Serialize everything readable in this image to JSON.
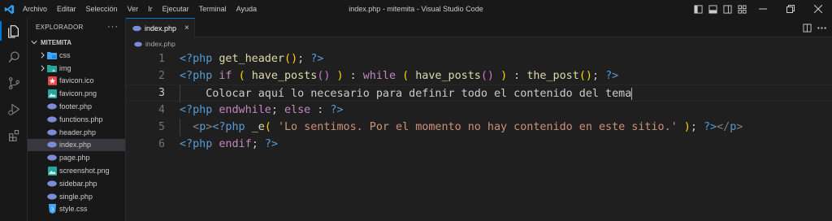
{
  "window": {
    "title": "index.php - mitemita - Visual Studio Code",
    "menu": [
      "Archivo",
      "Editar",
      "Selección",
      "Ver",
      "Ir",
      "Ejecutar",
      "Terminal",
      "Ayuda"
    ]
  },
  "sidebar": {
    "header": "EXPLORADOR",
    "more": "···",
    "folder": "MITEMITA",
    "items": [
      {
        "label": "css",
        "kind": "folder",
        "icon": "folder-css-icon"
      },
      {
        "label": "img",
        "kind": "folder",
        "icon": "folder-image-icon"
      },
      {
        "label": "favicon.ico",
        "kind": "file",
        "icon": "favicon-icon",
        "color": "#e8424b"
      },
      {
        "label": "favicon.png",
        "kind": "file",
        "icon": "image-file-icon",
        "color": "#26a69a"
      },
      {
        "label": "footer.php",
        "kind": "file",
        "icon": "php-icon",
        "color": "#7b8bd4"
      },
      {
        "label": "functions.php",
        "kind": "file",
        "icon": "php-icon",
        "color": "#7b8bd4"
      },
      {
        "label": "header.php",
        "kind": "file",
        "icon": "php-icon",
        "color": "#7b8bd4"
      },
      {
        "label": "index.php",
        "kind": "file",
        "icon": "php-icon",
        "color": "#7b8bd4",
        "selected": true
      },
      {
        "label": "page.php",
        "kind": "file",
        "icon": "php-icon",
        "color": "#7b8bd4"
      },
      {
        "label": "screenshot.png",
        "kind": "file",
        "icon": "image-file-icon",
        "color": "#26a69a"
      },
      {
        "label": "sidebar.php",
        "kind": "file",
        "icon": "php-icon",
        "color": "#7b8bd4"
      },
      {
        "label": "single.php",
        "kind": "file",
        "icon": "php-icon",
        "color": "#7b8bd4"
      },
      {
        "label": "style.css",
        "kind": "file",
        "icon": "css-file-icon",
        "color": "#42a5f5"
      }
    ]
  },
  "editor": {
    "tab_label": "index.php",
    "tab_close": "×",
    "breadcrumb": "index.php",
    "current_line": 3,
    "lines": [
      {
        "n": "1",
        "tokens": [
          [
            "<?php",
            "t-tag"
          ],
          [
            " ",
            "t-pu"
          ],
          [
            "get_header",
            "t-fn"
          ],
          [
            "(",
            "t-p1"
          ],
          [
            ")",
            "t-p1"
          ],
          [
            "; ",
            "t-pu"
          ],
          [
            "?>",
            "t-tag"
          ]
        ]
      },
      {
        "n": "2",
        "tokens": [
          [
            "<?php",
            "t-tag"
          ],
          [
            " ",
            "t-pu"
          ],
          [
            "if",
            "t-kw"
          ],
          [
            " ",
            "t-pu"
          ],
          [
            "(",
            "t-p1"
          ],
          [
            " ",
            "t-pu"
          ],
          [
            "have_posts",
            "t-fn"
          ],
          [
            "()",
            "t-p2"
          ],
          [
            " ",
            "t-pu"
          ],
          [
            ")",
            "t-p1"
          ],
          [
            " : ",
            "t-pu"
          ],
          [
            "while",
            "t-kw"
          ],
          [
            " ",
            "t-pu"
          ],
          [
            "(",
            "t-p1"
          ],
          [
            " ",
            "t-pu"
          ],
          [
            "have_posts",
            "t-fn"
          ],
          [
            "()",
            "t-p2"
          ],
          [
            " ",
            "t-pu"
          ],
          [
            ")",
            "t-p1"
          ],
          [
            " : ",
            "t-pu"
          ],
          [
            "the_post",
            "t-fn"
          ],
          [
            "()",
            "t-p1"
          ],
          [
            "; ",
            "t-pu"
          ],
          [
            "?>",
            "t-tag"
          ]
        ]
      },
      {
        "n": "3",
        "tokens": [
          [
            "    Colocar aquí lo necesario para definir todo el contenido del tema",
            "t-tx"
          ]
        ]
      },
      {
        "n": "4",
        "tokens": [
          [
            "<?php",
            "t-tag"
          ],
          [
            " ",
            "t-pu"
          ],
          [
            "endwhile",
            "t-kw"
          ],
          [
            "; ",
            "t-pu"
          ],
          [
            "else",
            "t-kw"
          ],
          [
            " : ",
            "t-pu"
          ],
          [
            "?>",
            "t-tag"
          ]
        ]
      },
      {
        "n": "5",
        "tokens": [
          [
            "  ",
            "t-pu"
          ],
          [
            "<",
            "t-htm"
          ],
          [
            "p",
            "t-hn"
          ],
          [
            ">",
            "t-htm"
          ],
          [
            "<?php",
            "t-tag"
          ],
          [
            " ",
            "t-pu"
          ],
          [
            "_e",
            "t-fn"
          ],
          [
            "(",
            "t-p1"
          ],
          [
            " ",
            "t-pu"
          ],
          [
            "'Lo sentimos. Por el momento no hay contenido en este sitio.'",
            "t-str"
          ],
          [
            " ",
            "t-pu"
          ],
          [
            ")",
            "t-p1"
          ],
          [
            "; ",
            "t-pu"
          ],
          [
            "?>",
            "t-tag"
          ],
          [
            "</",
            "t-htm"
          ],
          [
            "p",
            "t-hn"
          ],
          [
            ">",
            "t-htm"
          ]
        ]
      },
      {
        "n": "6",
        "tokens": [
          [
            "<?php",
            "t-tag"
          ],
          [
            " ",
            "t-pu"
          ],
          [
            "endif",
            "t-kw"
          ],
          [
            "; ",
            "t-pu"
          ],
          [
            "?>",
            "t-tag"
          ]
        ]
      }
    ]
  }
}
